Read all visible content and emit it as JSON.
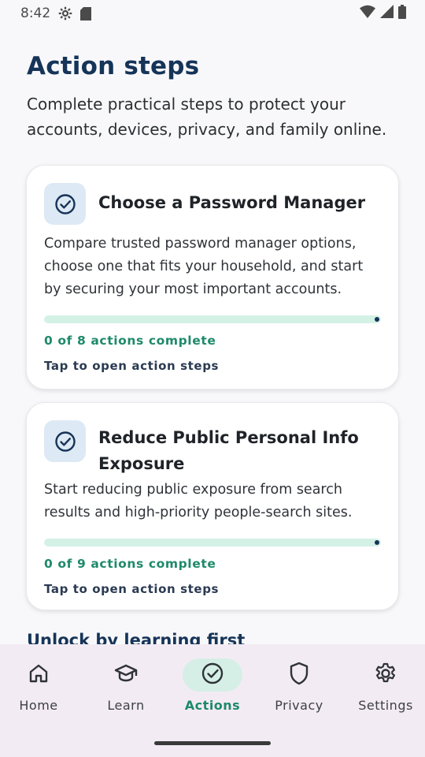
{
  "status_bar": {
    "time": "8:42"
  },
  "header": {
    "title": "Action steps",
    "subtitle": "Complete practical steps to protect your accounts, devices, privacy, and family online."
  },
  "cards": [
    {
      "title": "Choose a Password Manager",
      "description": "Compare trusted password manager options, choose one that fits your household, and start by securing your most important accounts.",
      "progress_text": "0 of 8 actions complete",
      "progress_fraction": 0,
      "hint": "Tap to open action steps"
    },
    {
      "title": "Reduce Public Personal Info Exposure",
      "description": "Start reducing public exposure from search results and high-priority people-search sites.",
      "progress_text": "0 of 9 actions complete",
      "progress_fraction": 0,
      "hint": "Tap to open action steps"
    }
  ],
  "section_peek": {
    "title": "Unlock by learning first"
  },
  "bottom_nav": {
    "items": [
      {
        "label": "Home",
        "icon": "home-icon"
      },
      {
        "label": "Learn",
        "icon": "graduation-cap-icon"
      },
      {
        "label": "Actions",
        "icon": "check-circle-icon",
        "active": true
      },
      {
        "label": "Privacy",
        "icon": "shield-icon"
      },
      {
        "label": "Settings",
        "icon": "gear-icon"
      }
    ]
  },
  "colors": {
    "primary_navy": "#163458",
    "accent_green": "#1e8a6a",
    "progress_track": "#d4f1e6",
    "icon_bg": "#dde9f4",
    "nav_bg": "#f3ebf3"
  }
}
